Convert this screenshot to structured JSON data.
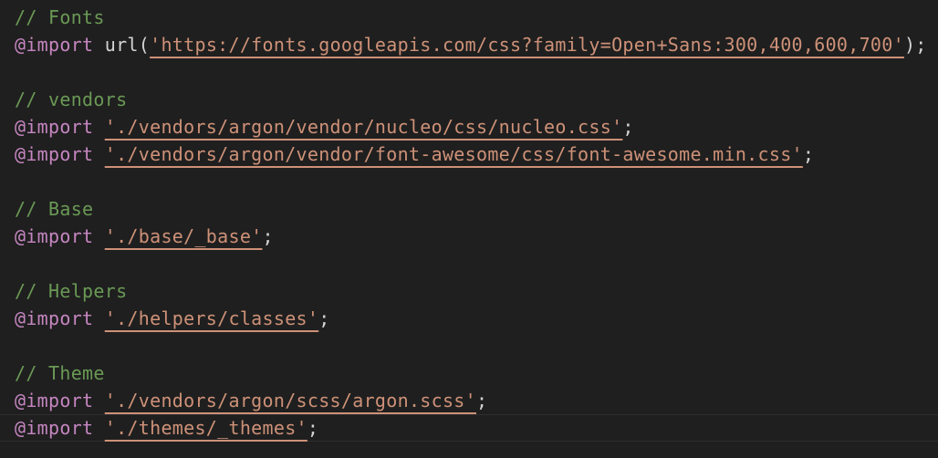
{
  "editor": {
    "lines": [
      {
        "type": "comment",
        "text": "// Fonts"
      },
      {
        "type": "import-url",
        "keyword": "@import",
        "fn": "url(",
        "value": "'https://fonts.googleapis.com/css?family=Open+Sans:300,400,600,700'",
        "end": ");"
      },
      {
        "type": "blank"
      },
      {
        "type": "comment",
        "text": "// vendors"
      },
      {
        "type": "import",
        "keyword": "@import",
        "value": "'./vendors/argon/vendor/nucleo/css/nucleo.css'",
        "end": ";"
      },
      {
        "type": "import",
        "keyword": "@import",
        "value": "'./vendors/argon/vendor/font-awesome/css/font-awesome.min.css'",
        "end": ";"
      },
      {
        "type": "blank"
      },
      {
        "type": "comment",
        "text": "// Base"
      },
      {
        "type": "import",
        "keyword": "@import",
        "value": "'./base/_base'",
        "end": ";"
      },
      {
        "type": "blank"
      },
      {
        "type": "comment",
        "text": "// Helpers"
      },
      {
        "type": "import",
        "keyword": "@import",
        "value": "'./helpers/classes'",
        "end": ";"
      },
      {
        "type": "blank"
      },
      {
        "type": "comment",
        "text": "// Theme"
      },
      {
        "type": "import",
        "keyword": "@import",
        "value": "'./vendors/argon/scss/argon.scss'",
        "end": ";"
      },
      {
        "type": "import",
        "keyword": "@import",
        "value": "'./themes/_themes'",
        "end": ";",
        "current": true
      }
    ]
  },
  "colors": {
    "background": "#1f1f1f",
    "comment": "#6a9955",
    "keyword": "#c586c0",
    "string": "#ce9178",
    "text": "#d4d4d4"
  }
}
